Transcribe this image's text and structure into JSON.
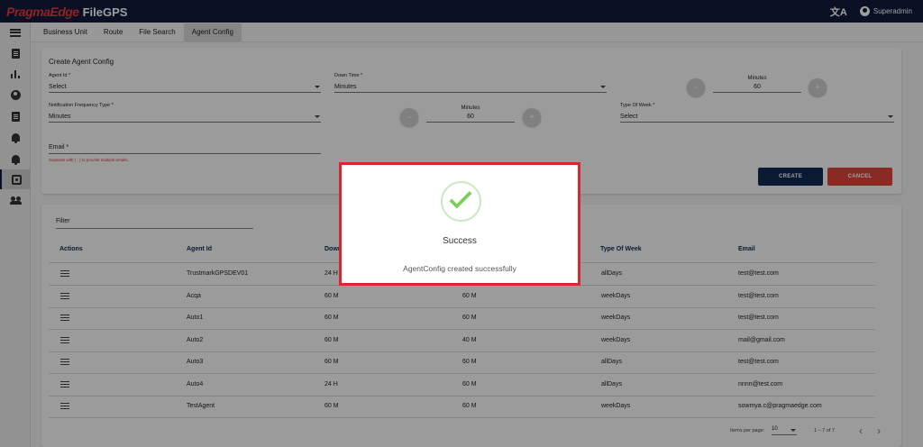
{
  "app": {
    "brand": "PragmaEdge",
    "product": "FileGPS"
  },
  "topbar": {
    "user_name": "Superadmin",
    "translate_icon": "translate-icon",
    "user_icon": "account-circle-icon"
  },
  "sidebar": {
    "items": [
      {
        "icon": "menu-icon"
      },
      {
        "icon": "documents-icon"
      },
      {
        "icon": "bar-chart-icon"
      },
      {
        "icon": "account-icon"
      },
      {
        "icon": "report-icon"
      },
      {
        "icon": "alert-icon"
      },
      {
        "icon": "alert-settings-icon"
      },
      {
        "icon": "agent-config-icon",
        "active": true
      },
      {
        "icon": "users-icon"
      }
    ]
  },
  "tabs": [
    {
      "label": "Business Unit"
    },
    {
      "label": "Route"
    },
    {
      "label": "File Search"
    },
    {
      "label": "Agent Config",
      "active": true
    }
  ],
  "form": {
    "title": "Create Agent Config",
    "agent_id": {
      "label": "Agent Id *",
      "value": "Select"
    },
    "down_time": {
      "label": "Down Time *",
      "value": "Minutes"
    },
    "down_time_minutes": {
      "label": "Minutes",
      "value": "60"
    },
    "notification_frequency": {
      "label": "Notification Frequency Type *",
      "value": "Minutes"
    },
    "notification_minutes": {
      "label": "Minutes",
      "value": "60"
    },
    "type_of_week": {
      "label": "Type Of Week *",
      "value": "Select"
    },
    "email": {
      "label": "Email *",
      "hint": "Separate with ( , ) to provide multiple emails."
    },
    "decrement_label": "-",
    "increment_label": "+",
    "create_label": "CREATE",
    "cancel_label": "CANCEL"
  },
  "table": {
    "filter_label": "Filter",
    "columns": [
      "Actions",
      "Agent Id",
      "Down",
      "",
      "Type Of Week",
      "Email"
    ],
    "rows": [
      {
        "agent_id": "TrustmarkGPSDEV01",
        "down_time": "24 H",
        "frequency": "",
        "week": "allDays",
        "email": "test@test.com"
      },
      {
        "agent_id": "Acqa",
        "down_time": "60 M",
        "frequency": "60 M",
        "week": "weekDays",
        "email": "test@test.com"
      },
      {
        "agent_id": "Auto1",
        "down_time": "60 M",
        "frequency": "60 M",
        "week": "weekDays",
        "email": "test@test.com"
      },
      {
        "agent_id": "Auto2",
        "down_time": "60 M",
        "frequency": "40 M",
        "week": "weekDays",
        "email": "mail@gmail.com"
      },
      {
        "agent_id": "Auto3",
        "down_time": "60 M",
        "frequency": "60 M",
        "week": "allDays",
        "email": "test@test.com"
      },
      {
        "agent_id": "Auto4",
        "down_time": "24 H",
        "frequency": "60 M",
        "week": "allDays",
        "email": "nnnn@test.com"
      },
      {
        "agent_id": "TestAgent",
        "down_time": "60 M",
        "frequency": "60 M",
        "week": "weekDays",
        "email": "sowmya.c@pragmaedge.com"
      }
    ],
    "paginator": {
      "items_per_page_label": "Items per page:",
      "page_size": "10",
      "range": "1 – 7 of 7",
      "prev": "‹",
      "next": "›"
    }
  },
  "dialog": {
    "title": "Success",
    "message": "AgentConfig created successfully",
    "icon": "check-icon"
  },
  "colors": {
    "topbar": "#0f1a3a",
    "brand_red": "#e8383b",
    "create_button": "#0f2a52",
    "cancel_button": "#e0443b",
    "dialog_border": "#d7272f",
    "success_check": "#7ccf56"
  }
}
